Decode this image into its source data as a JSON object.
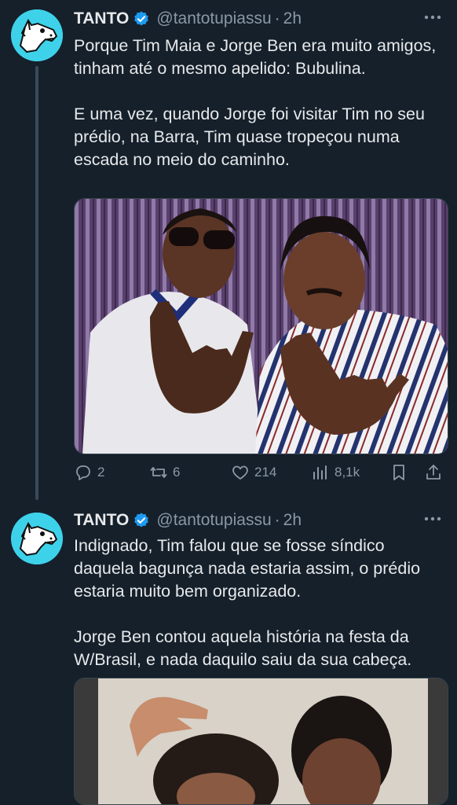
{
  "tweets": [
    {
      "author_name": "TANTO",
      "handle": "@tantotupiassu",
      "separator": "·",
      "time": "2h",
      "text": "Porque Tim Maia e Jorge Ben era muito amigos, tinham até o mesmo apelido: Bubulina.\n\nE uma vez, quando Jorge foi visitar Tim no seu prédio, na Barra, Tim quase tropeçou numa escada no meio do caminho.",
      "replies": "2",
      "retweets": "6",
      "likes": "214",
      "views": "8,1k"
    },
    {
      "author_name": "TANTO",
      "handle": "@tantotupiassu",
      "separator": "·",
      "time": "2h",
      "text": "Indignado, Tim falou que se fosse síndico daquela bagunça nada estaria assim, o prédio estaria muito bem organizado.\n\nJorge Ben contou aquela história na festa da W/Brasil, e nada daquilo saiu da sua cabeça."
    }
  ],
  "colors": {
    "background": "#15202b",
    "avatar": "#3ed2ea",
    "verified": "#1d9bf0",
    "muted": "#8b98a5"
  },
  "icons": [
    "verified-badge-icon",
    "more-icon",
    "reply-icon",
    "retweet-icon",
    "like-icon",
    "views-icon",
    "bookmark-icon",
    "share-icon"
  ]
}
